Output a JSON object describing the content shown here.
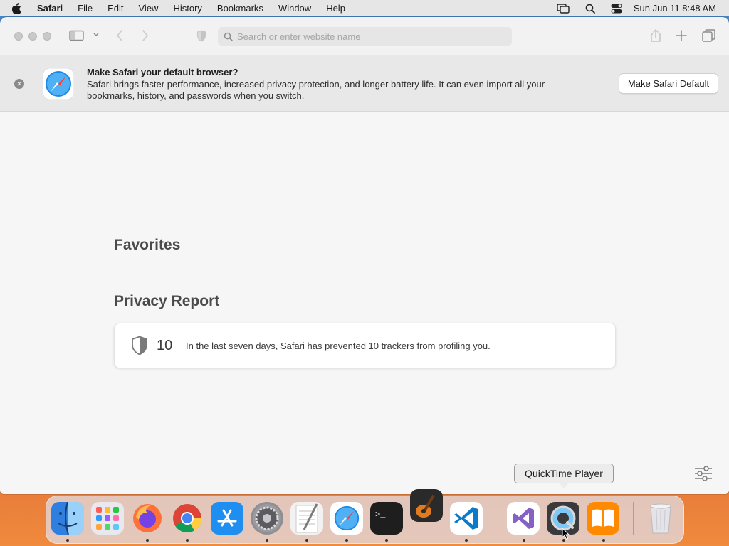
{
  "menubar": {
    "app_name": "Safari",
    "items": [
      "File",
      "Edit",
      "View",
      "History",
      "Bookmarks",
      "Window",
      "Help"
    ],
    "datetime": "Sun Jun 11  8:48 AM"
  },
  "toolbar": {
    "search_placeholder": "Search or enter website name"
  },
  "banner": {
    "title": "Make Safari your default browser?",
    "description": "Safari brings faster performance, increased privacy protection, and longer battery life. It can even import all your bookmarks, history, and passwords when you switch.",
    "button_label": "Make Safari Default"
  },
  "content": {
    "favorites_title": "Favorites",
    "privacy_title": "Privacy Report",
    "tracker_count": "10",
    "privacy_message": "In the last seven days, Safari has prevented 10 trackers from profiling you."
  },
  "tooltip": {
    "label": "QuickTime Player"
  },
  "dock": {
    "apps": [
      {
        "name": "finder-icon",
        "color": "#3a8ee6"
      },
      {
        "name": "launchpad-icon",
        "color": "#e8e8ee"
      },
      {
        "name": "firefox-icon",
        "color": "#ff7139"
      },
      {
        "name": "chrome-icon",
        "color": "#ffffff"
      },
      {
        "name": "app-store-icon",
        "color": "#1f8ef1"
      },
      {
        "name": "system-preferences-icon",
        "color": "#8e8e93"
      },
      {
        "name": "textedit-icon",
        "color": "#f2f2f2"
      },
      {
        "name": "safari-icon",
        "color": "#ffffff"
      },
      {
        "name": "terminal-icon",
        "color": "#1e1e1e"
      },
      {
        "name": "garageband-icon",
        "color": "#2a2a2a"
      },
      {
        "name": "vscode-icon",
        "color": "#ffffff"
      },
      {
        "name": "visual-studio-icon",
        "color": "#ffffff"
      },
      {
        "name": "quicktime-icon",
        "color": "#3a3a3c"
      },
      {
        "name": "books-icon",
        "color": "#ff8a00"
      },
      {
        "name": "trash-icon",
        "color": "#e3e3e8"
      }
    ]
  }
}
